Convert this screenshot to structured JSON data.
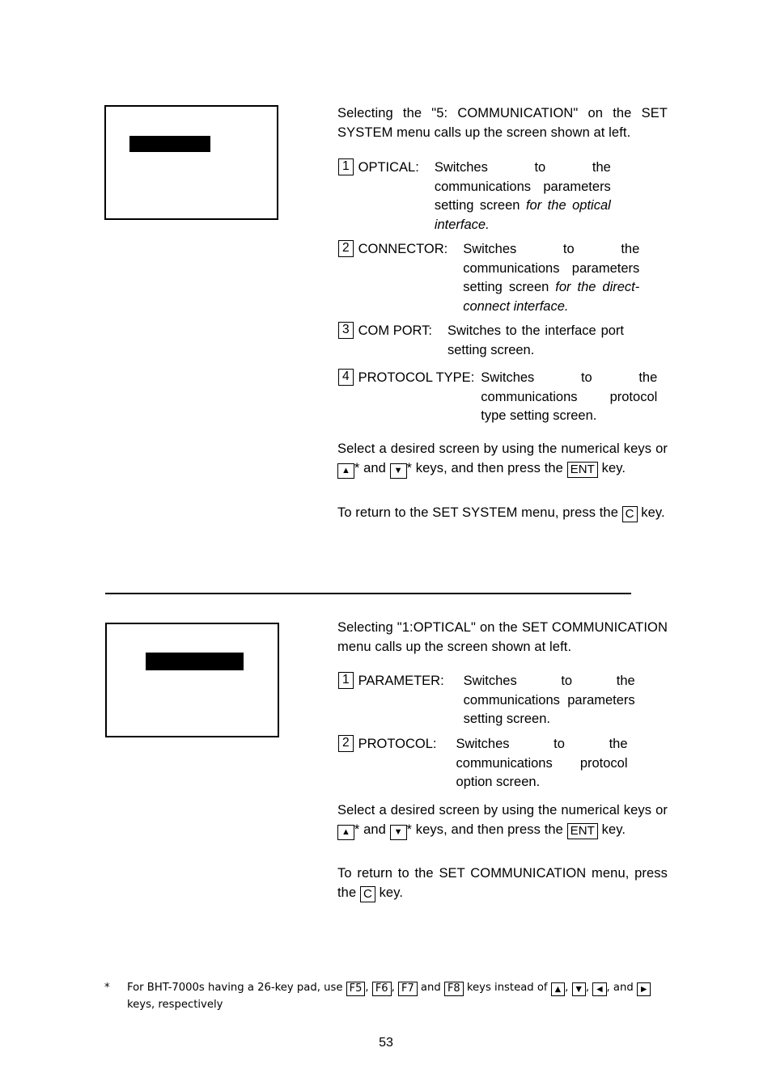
{
  "page": {
    "number": "53"
  },
  "section1": {
    "screen": {
      "caption": ""
    },
    "intro": "Selecting the \"5: COMMUNICATION\" on the SET SYSTEM menu calls up the screen shown at left.",
    "items": [
      {
        "key": "1",
        "term": "OPTICAL:",
        "desc_plain": "Switches to the communications parameters setting screen ",
        "desc_italic": "for the optical interface."
      },
      {
        "key": "2",
        "term": "CONNECTOR:",
        "desc_plain": "Switches to the communications parameters setting screen ",
        "desc_italic": "for the direct-connect interface."
      },
      {
        "key": "3",
        "term": "COM PORT:",
        "desc_plain": "Switches to the interface port setting screen.",
        "desc_italic": ""
      },
      {
        "key": "4",
        "term": "PROTOCOL TYPE:",
        "desc_plain": "Switches to the communications protocol type setting screen.",
        "desc_italic": ""
      }
    ],
    "select_text": {
      "part1": "Select a desired screen by using the numerical keys or",
      "key_up": "▲",
      "star1": "*",
      "and": "and",
      "key_down": "▼",
      "star2": "*",
      "part2": "keys, and then press the",
      "key_ent": "ENT",
      "part3": "key."
    },
    "return_text": {
      "part1": "To return to the SET SYSTEM menu, press the",
      "key_c": "C",
      "part2": "key."
    }
  },
  "section2": {
    "screen": {
      "caption": ""
    },
    "intro": "Selecting \"1:OPTICAL\" on the SET COMMUNICATION menu calls up the screen shown at left.",
    "items": [
      {
        "key": "1",
        "term": "PARAMETER:",
        "desc_plain": "Switches to the communications parameters setting screen.",
        "desc_italic": ""
      },
      {
        "key": "2",
        "term": "PROTOCOL:",
        "desc_plain": "Switches to the communications protocol option screen.",
        "desc_italic": ""
      }
    ],
    "select_text": {
      "part1": "Select a desired screen by using the numerical keys or",
      "key_up": "▲",
      "star1": "*",
      "and": "and",
      "key_down": "▼",
      "star2": "*",
      "part2": "keys, and then press the",
      "key_ent": "ENT",
      "part3": "key."
    },
    "return_text": {
      "part1": "To return to the SET COMMUNICATION menu, press the",
      "key_c": "C",
      "part2": "key."
    }
  },
  "footnote": {
    "mark": "*",
    "part1": "For BHT-7000s having a 26-key pad, use",
    "key_f5": "F5",
    "sep1": ",",
    "key_f6": "F6",
    "sep2": ",",
    "key_f7": "F7",
    "and": "and",
    "key_f8": "F8",
    "part2": "keys instead of",
    "key_up": "▲",
    "sep3": ",",
    "key_down": "▼",
    "sep4": ",",
    "key_left": "◀",
    "sep5": ", and",
    "key_right": "▶",
    "part3": "keys, respectively"
  }
}
